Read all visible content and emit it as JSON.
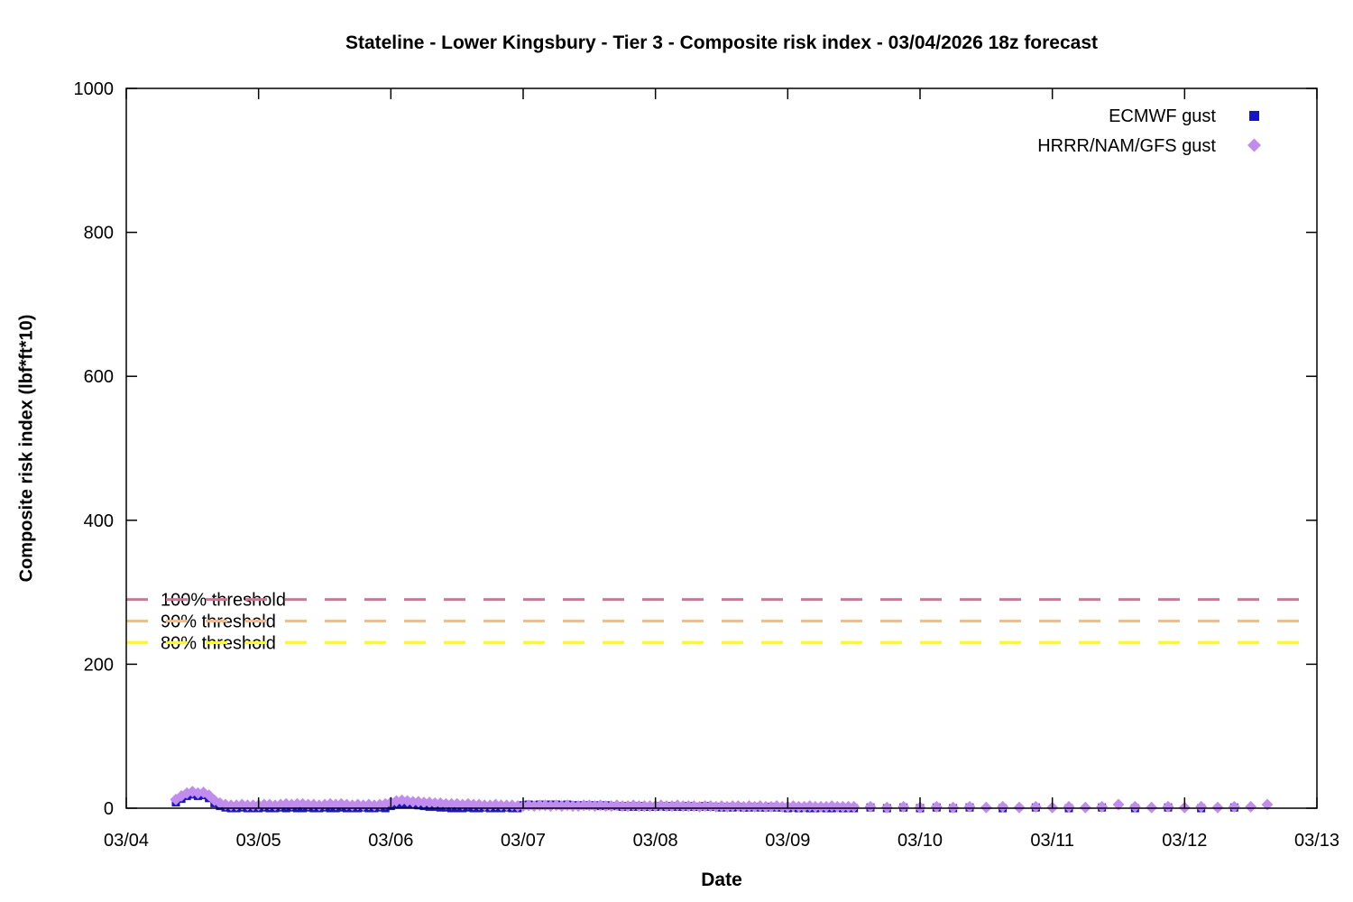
{
  "chart_data": {
    "type": "scatter",
    "title": "Stateline - Lower Kingsbury - Tier 3 - Composite risk index - 03/04/2026 18z forecast",
    "xlabel": "Date",
    "ylabel": "Composite risk index (lbf*ft*10)",
    "x_unit": "hours since 03/04 00z",
    "xlim_days": [
      0,
      9
    ],
    "x_tick_labels": [
      "03/04",
      "03/05",
      "03/06",
      "03/07",
      "03/08",
      "03/09",
      "03/10",
      "03/11",
      "03/12",
      "03/13"
    ],
    "ylim": [
      0,
      1000
    ],
    "y_ticks": [
      0,
      200,
      400,
      600,
      800,
      1000
    ],
    "grid": false,
    "legend_position": "top-right-inside",
    "axis_color": "#000000",
    "thresholds": [
      {
        "label": "100% threshold",
        "value": 290,
        "color": "#DB7093"
      },
      {
        "label": "90% threshold",
        "value": 260,
        "color": "#FFB880"
      },
      {
        "label": "80% threshold",
        "value": 230,
        "color": "#FFFF00"
      }
    ],
    "series": [
      {
        "name": "ECMWF gust",
        "marker": "square",
        "color": "#1515CD",
        "start_hour": 9,
        "hourly_values": [
          8,
          13,
          17,
          19,
          17,
          18,
          14,
          7,
          3,
          1,
          0,
          0,
          1,
          0,
          0,
          0,
          1,
          0,
          0,
          1,
          0,
          1,
          0,
          0,
          1,
          0,
          0,
          1,
          0,
          0,
          1,
          0,
          0,
          0,
          1,
          0,
          0,
          1,
          0,
          3,
          5,
          6,
          6,
          5,
          4,
          3,
          2,
          2,
          1,
          1,
          0,
          0,
          0,
          1,
          0,
          0,
          1,
          0,
          0,
          0,
          1,
          0,
          0,
          4,
          5,
          4,
          5,
          4,
          5,
          5,
          4,
          5,
          4,
          4,
          4,
          4,
          4,
          3,
          4,
          3,
          3,
          2,
          3,
          2,
          3,
          2,
          2,
          2,
          3,
          2,
          3,
          2,
          2,
          3,
          2,
          2,
          3,
          2,
          2,
          1,
          2,
          1,
          2,
          1,
          1,
          2,
          1,
          1,
          2,
          1,
          1,
          0,
          1,
          0,
          1,
          0,
          0,
          1,
          0,
          0,
          1,
          0,
          0,
          0
        ],
        "extra_points": [
          [
            135,
            1
          ],
          [
            138,
            0
          ],
          [
            141,
            1
          ],
          [
            144,
            0
          ],
          [
            147,
            1
          ],
          [
            150,
            0
          ],
          [
            153,
            1
          ],
          [
            159,
            0
          ],
          [
            165,
            1
          ],
          [
            171,
            0
          ],
          [
            177,
            1
          ],
          [
            183,
            0
          ],
          [
            189,
            1
          ],
          [
            195,
            0
          ],
          [
            201,
            1
          ]
        ]
      },
      {
        "name": "HRRR/NAM/GFS gust",
        "marker": "diamond",
        "color": "#C28BF0",
        "start_hour": 9,
        "hourly_values": [
          12,
          17,
          21,
          23,
          21,
          22,
          18,
          11,
          7,
          5,
          4,
          4,
          5,
          4,
          4,
          4,
          5,
          5,
          4,
          5,
          6,
          5,
          6,
          6,
          5,
          5,
          4,
          5,
          6,
          5,
          6,
          5,
          4,
          5,
          4,
          5,
          4,
          5,
          6,
          8,
          10,
          11,
          10,
          9,
          9,
          8,
          8,
          7,
          7,
          6,
          6,
          6,
          5,
          6,
          5,
          5,
          4,
          4,
          5,
          4,
          4,
          4,
          3,
          3,
          4,
          3,
          4,
          4,
          3,
          4,
          3,
          4,
          3,
          3,
          4,
          4,
          3,
          4,
          3,
          3,
          4,
          3,
          3,
          4,
          3,
          3,
          3,
          3,
          4,
          3,
          3,
          4,
          3,
          3,
          3,
          2,
          3,
          3,
          2,
          3,
          2,
          3,
          3,
          2,
          3,
          2,
          3,
          2,
          2,
          3,
          2,
          2,
          3,
          2,
          2,
          3,
          2,
          2,
          2,
          3,
          2,
          2,
          2,
          2
        ],
        "extra_points": [
          [
            135,
            2
          ],
          [
            138,
            1
          ],
          [
            141,
            2
          ],
          [
            144,
            1
          ],
          [
            147,
            2
          ],
          [
            150,
            1
          ],
          [
            153,
            2
          ],
          [
            156,
            1
          ],
          [
            159,
            2
          ],
          [
            162,
            1
          ],
          [
            165,
            2
          ],
          [
            168,
            1
          ],
          [
            171,
            2
          ],
          [
            174,
            1
          ],
          [
            177,
            2
          ],
          [
            180,
            5
          ],
          [
            183,
            2
          ],
          [
            186,
            1
          ],
          [
            189,
            2
          ],
          [
            192,
            1
          ],
          [
            195,
            2
          ],
          [
            198,
            1
          ],
          [
            201,
            2
          ],
          [
            204,
            2
          ],
          [
            207,
            5
          ]
        ]
      }
    ]
  }
}
